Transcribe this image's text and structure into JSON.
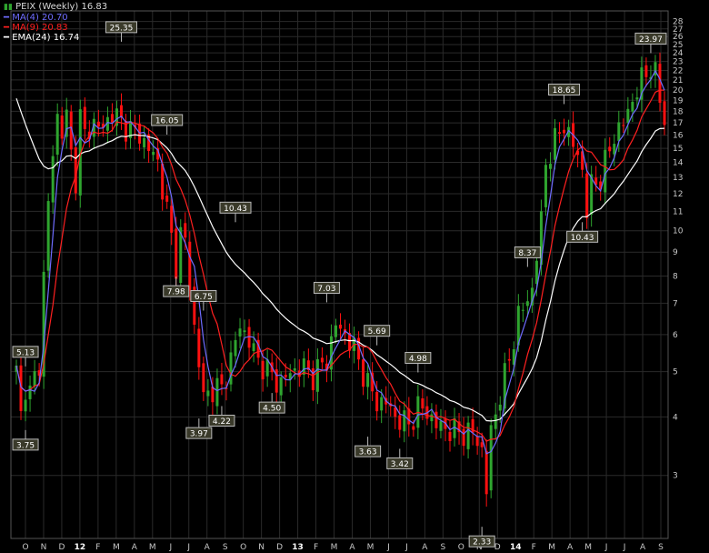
{
  "chart_data": {
    "type": "candlestick",
    "symbol": "PEIX",
    "period": "Weekly",
    "scale": "log",
    "grid": true,
    "legend": [
      {
        "label": "PEIX (Weekly) 16.83",
        "color": "#d8d8d8"
      },
      {
        "label": "MA(4) 20.70",
        "color": "#6f6cff"
      },
      {
        "label": "MA(9) 20.83",
        "color": "#ff2020"
      },
      {
        "label": "EMA(24) 16.74",
        "color": "#ffffff"
      }
    ],
    "y_ticks": [
      3,
      4,
      5,
      6,
      7,
      8,
      9,
      10,
      11,
      12,
      13,
      14,
      15,
      16,
      17,
      18,
      19,
      20,
      21,
      22,
      23,
      24,
      25,
      26,
      27,
      28
    ],
    "ylim": [
      2.2,
      29.5
    ],
    "x_tick_labels": [
      "O",
      "N",
      "D",
      "12",
      "F",
      "M",
      "A",
      "M",
      "J",
      "J",
      "A",
      "S",
      "O",
      "N",
      "D",
      "13",
      "F",
      "M",
      "A",
      "M",
      "J",
      "J",
      "A",
      "S",
      "O",
      "N",
      "D",
      "14",
      "F",
      "M",
      "A",
      "M",
      "J",
      "J",
      "A",
      "S"
    ],
    "bold_x_labels": [
      "12",
      "13",
      "14"
    ],
    "up_color": "#2fa52f",
    "down_color": "#ff1010",
    "price_keypoints": [
      {
        "w": 0,
        "p": 5.0
      },
      {
        "w": 1,
        "p": 4.0
      },
      {
        "w": 2,
        "p": 4.7
      },
      {
        "w": 3,
        "p": 4.5
      },
      {
        "w": 5,
        "p": 5.2
      },
      {
        "w": 6,
        "p": 8.0
      },
      {
        "w": 7,
        "p": 11.5
      },
      {
        "w": 8,
        "p": 14.5
      },
      {
        "w": 9,
        "p": 17.5
      },
      {
        "w": 10,
        "p": 16.5
      },
      {
        "w": 11,
        "p": 17.5
      },
      {
        "w": 12,
        "p": 14.5
      },
      {
        "w": 13,
        "p": 13.0
      },
      {
        "w": 14,
        "p": 17.5
      },
      {
        "w": 15,
        "p": 16.0
      },
      {
        "w": 17,
        "p": 17.0
      },
      {
        "w": 19,
        "p": 16.5
      },
      {
        "w": 21,
        "p": 18.0
      },
      {
        "w": 23,
        "p": 17.0
      },
      {
        "w": 25,
        "p": 16.5
      },
      {
        "w": 27,
        "p": 16.0
      },
      {
        "w": 29,
        "p": 15.0
      },
      {
        "w": 31,
        "p": 14.0
      },
      {
        "w": 33,
        "p": 11.0
      },
      {
        "w": 35,
        "p": 8.5
      },
      {
        "w": 36,
        "p": 9.8
      },
      {
        "w": 37,
        "p": 9.5
      },
      {
        "w": 39,
        "p": 6.2
      },
      {
        "w": 41,
        "p": 4.4
      },
      {
        "w": 43,
        "p": 4.6
      },
      {
        "w": 45,
        "p": 4.6
      },
      {
        "w": 47,
        "p": 5.3
      },
      {
        "w": 49,
        "p": 6.3
      },
      {
        "w": 51,
        "p": 5.8
      },
      {
        "w": 53,
        "p": 5.3
      },
      {
        "w": 56,
        "p": 4.9
      },
      {
        "w": 58,
        "p": 4.7
      },
      {
        "w": 60,
        "p": 5.0
      },
      {
        "w": 63,
        "p": 5.1
      },
      {
        "w": 65,
        "p": 4.9
      },
      {
        "w": 68,
        "p": 5.3
      },
      {
        "w": 70,
        "p": 6.3
      },
      {
        "w": 72,
        "p": 6.0
      },
      {
        "w": 74,
        "p": 5.6
      },
      {
        "w": 77,
        "p": 4.7
      },
      {
        "w": 79,
        "p": 4.3
      },
      {
        "w": 81,
        "p": 4.3
      },
      {
        "w": 83,
        "p": 4.0
      },
      {
        "w": 86,
        "p": 3.85
      },
      {
        "w": 88,
        "p": 4.2
      },
      {
        "w": 90,
        "p": 4.1
      },
      {
        "w": 92,
        "p": 3.85
      },
      {
        "w": 95,
        "p": 3.75
      },
      {
        "w": 98,
        "p": 3.7
      },
      {
        "w": 100,
        "p": 3.7
      },
      {
        "w": 102,
        "p": 3.4
      },
      {
        "w": 103,
        "p": 2.8
      },
      {
        "w": 104,
        "p": 3.7
      },
      {
        "w": 106,
        "p": 4.5
      },
      {
        "w": 108,
        "p": 5.3
      },
      {
        "w": 110,
        "p": 6.6
      },
      {
        "w": 111,
        "p": 6.8
      },
      {
        "w": 113,
        "p": 7.5
      },
      {
        "w": 115,
        "p": 10.5
      },
      {
        "w": 116,
        "p": 14.0
      },
      {
        "w": 118,
        "p": 15.5
      },
      {
        "w": 120,
        "p": 17.0
      },
      {
        "w": 121,
        "p": 16.0
      },
      {
        "w": 123,
        "p": 14.5
      },
      {
        "w": 124,
        "p": 13.5
      },
      {
        "w": 125,
        "p": 11.0
      },
      {
        "w": 126,
        "p": 12.5
      },
      {
        "w": 128,
        "p": 13.0
      },
      {
        "w": 131,
        "p": 16.0
      },
      {
        "w": 133,
        "p": 17.0
      },
      {
        "w": 135,
        "p": 19.0
      },
      {
        "w": 137,
        "p": 21.0
      },
      {
        "w": 139,
        "p": 22.5
      },
      {
        "w": 140,
        "p": 21.5
      },
      {
        "w": 141,
        "p": 19.0
      },
      {
        "w": 142,
        "p": 16.83
      }
    ],
    "annotations": [
      {
        "text": "3.75",
        "w": 2,
        "value": 3.75,
        "pos": "below"
      },
      {
        "text": "5.13",
        "w": 2,
        "value": 5.13,
        "pos": "above"
      },
      {
        "text": "25.35",
        "w": 23,
        "value": 25.35,
        "pos": "above"
      },
      {
        "text": "16.05",
        "w": 33,
        "value": 16.05,
        "pos": "above"
      },
      {
        "text": "7.98",
        "w": 35,
        "value": 7.98,
        "pos": "below"
      },
      {
        "text": "6.75",
        "w": 41,
        "value": 6.75,
        "pos": "above"
      },
      {
        "text": "3.97",
        "w": 40,
        "value": 3.97,
        "pos": "below"
      },
      {
        "text": "4.22",
        "w": 45,
        "value": 4.22,
        "pos": "below"
      },
      {
        "text": "10.43",
        "w": 48,
        "value": 10.43,
        "pos": "above"
      },
      {
        "text": "4.50",
        "w": 56,
        "value": 4.5,
        "pos": "below"
      },
      {
        "text": "7.03",
        "w": 68,
        "value": 7.03,
        "pos": "above"
      },
      {
        "text": "5.69",
        "w": 79,
        "value": 5.69,
        "pos": "above"
      },
      {
        "text": "3.63",
        "w": 77,
        "value": 3.63,
        "pos": "below"
      },
      {
        "text": "3.42",
        "w": 84,
        "value": 3.42,
        "pos": "below"
      },
      {
        "text": "4.98",
        "w": 88,
        "value": 4.98,
        "pos": "above"
      },
      {
        "text": "2.33",
        "w": 102,
        "value": 2.33,
        "pos": "below"
      },
      {
        "text": "8.37",
        "w": 112,
        "value": 8.37,
        "pos": "above"
      },
      {
        "text": "18.65",
        "w": 120,
        "value": 18.65,
        "pos": "above"
      },
      {
        "text": "10.43",
        "w": 124,
        "value": 10.43,
        "pos": "below"
      },
      {
        "text": "23.97",
        "w": 139,
        "value": 23.97,
        "pos": "above"
      }
    ]
  }
}
